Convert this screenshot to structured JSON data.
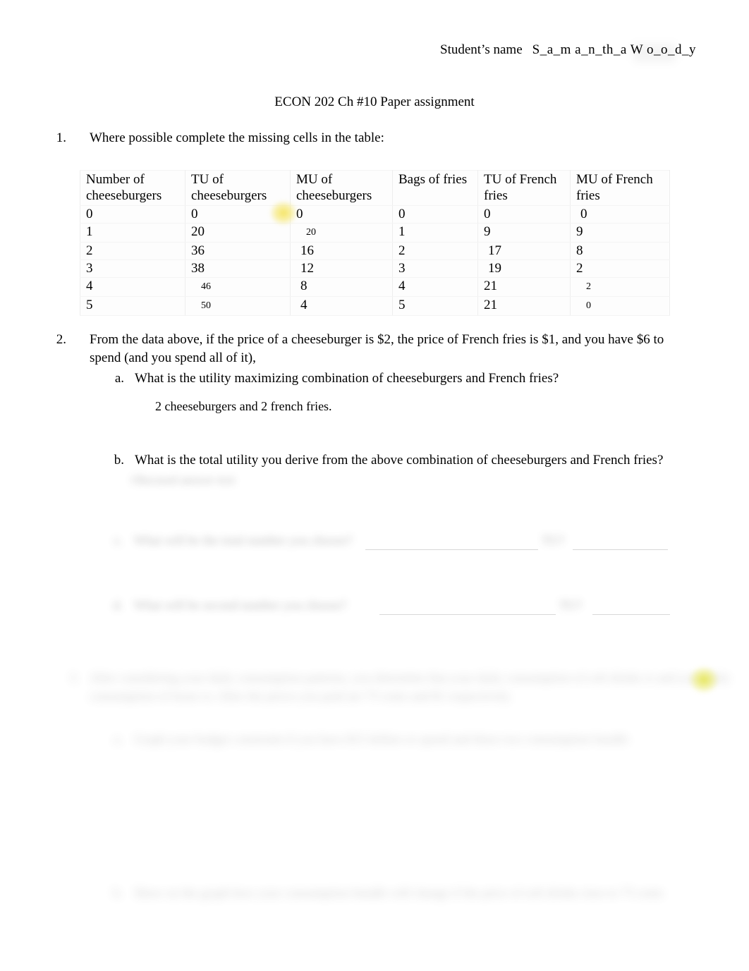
{
  "header": {
    "student_label": "Student’s name",
    "student_name": "S_a_m  a_n_th_a   W o_o_d_y",
    "title": "ECON 202 Ch #10 Paper assignment"
  },
  "questions": {
    "q1": {
      "number": "1.",
      "text": "Where possible complete the missing cells in the table:"
    },
    "q2": {
      "number": "2.",
      "text": "From the data above, if the price of a cheeseburger is $2, the price of French fries is $1, and you have $6 to spend (and you spend all of it),",
      "a": {
        "letter": "a.",
        "text": "What is the utility maximizing combination of cheeseburgers and French fries?",
        "answer": "2 cheeseburgers and 2 french fries."
      },
      "b": {
        "letter": "b.",
        "text": "What is the total utility you derive from the above combination of cheeseburgers and French fries?",
        "answer": "Obscured answer text"
      },
      "c": {
        "letter": "c.",
        "text": "What will be the total number you choose?",
        "blank_suffix": "TU?"
      },
      "d": {
        "letter": "d.",
        "text": "What will be second number you choose?",
        "blank_suffix": "TU?"
      }
    },
    "q3": {
      "number": "3.",
      "text": "After considering your daily consumption patterns, you determine that your daily consumption of soft drinks is and your daily consumption of hours is. After the prices you paid are 75 cents and $1 respectively.",
      "a": {
        "letter": "a.",
        "text": "Graph your budget constraint if you have $15 dollars to spend and these two consumption bundle"
      },
      "b": {
        "letter": "b.",
        "text": "Show on the graph how your consumption bundle will change if the price of soft drinks rises to 75 cents"
      }
    }
  },
  "table": {
    "headers": [
      "Number of cheeseburgers",
      "TU of cheeseburgers",
      "MU of cheeseburgers",
      "Bags of fries",
      "TU of French fries",
      "MU of French fries"
    ],
    "rows": [
      {
        "qty_burgers": "0",
        "tu_burgers": "0",
        "mu_burgers": "0",
        "qty_fries": "0",
        "tu_fries": "0",
        "mu_fries": "0"
      },
      {
        "qty_burgers": "1",
        "tu_burgers": "20",
        "mu_burgers": "20",
        "qty_fries": "1",
        "tu_fries": "9",
        "mu_fries": "9"
      },
      {
        "qty_burgers": "2",
        "tu_burgers": "36",
        "mu_burgers": "16",
        "qty_fries": "2",
        "tu_fries": "17",
        "mu_fries": "8"
      },
      {
        "qty_burgers": "3",
        "tu_burgers": "38",
        "mu_burgers": "12",
        "qty_fries": "3",
        "tu_fries": "19",
        "mu_fries": "2"
      },
      {
        "qty_burgers": "4",
        "tu_burgers": "46",
        "mu_burgers": "8",
        "qty_fries": "4",
        "tu_fries": "21",
        "mu_fries": "2"
      },
      {
        "qty_burgers": "5",
        "tu_burgers": "50",
        "mu_burgers": "4",
        "qty_fries": "5",
        "tu_fries": "21",
        "mu_fries": "0"
      }
    ]
  },
  "colors": {
    "highlight_yellow": "#f4e25a",
    "table_border": "#eeeeee",
    "text": "#000000"
  }
}
